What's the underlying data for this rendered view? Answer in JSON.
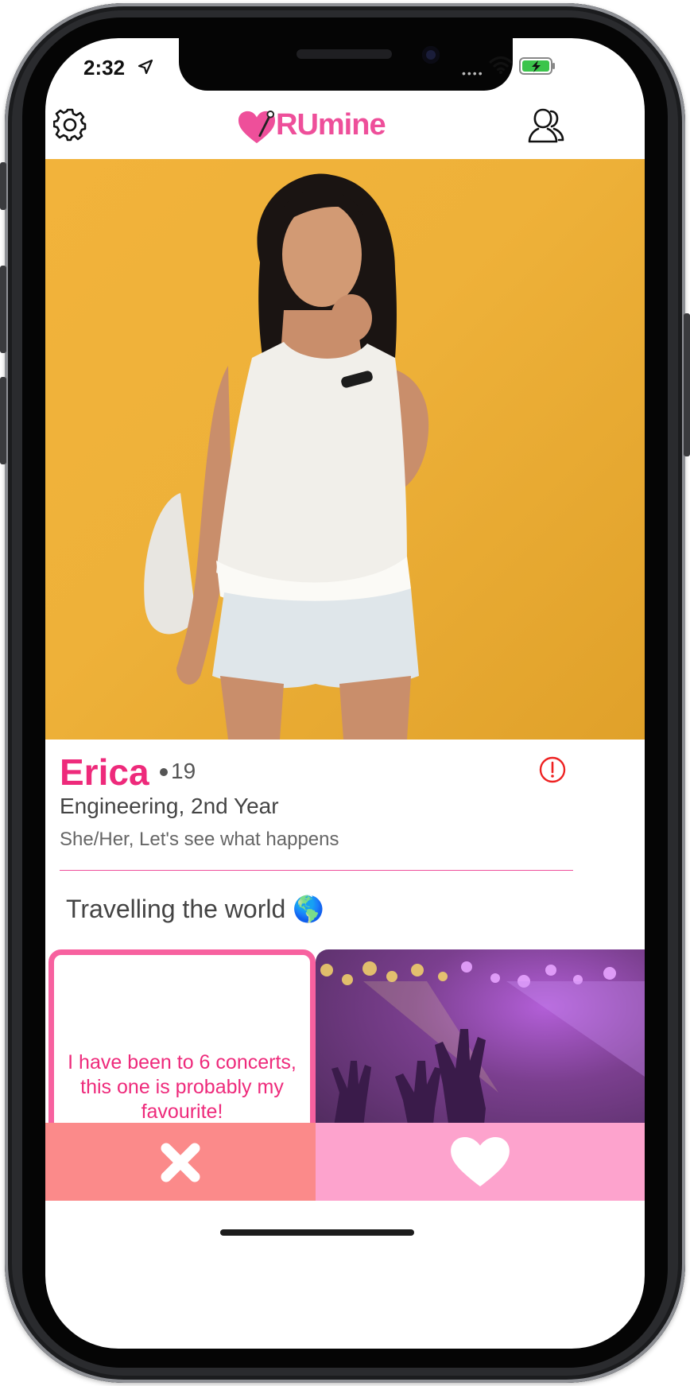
{
  "status_bar": {
    "time": "2:32",
    "icons": [
      "location-arrow-icon",
      "wifi-icon",
      "battery-charging-icon"
    ]
  },
  "header": {
    "settings_icon": "gear-icon",
    "logo_text": "RUmine",
    "profile_icon": "user-icon"
  },
  "profile": {
    "name": "Erica",
    "age": "19",
    "program": "Engineering, 2nd Year",
    "details": "She/Her, Let's see what happens",
    "prompt": "Travelling the world 🌎",
    "report_icon": "alert-circle-icon"
  },
  "cards": {
    "text_card": "I have been to 6 concerts, this one is probably my favourite!"
  },
  "actions": {
    "pass_icon": "close-icon",
    "like_icon": "heart-icon"
  },
  "colors": {
    "brand_pink": "#ee2a7b",
    "logo_pink": "#ee4f9a",
    "pass_bg": "#fb8a8a",
    "like_bg": "#fda3cd",
    "photo_bg": "#f0b236"
  }
}
